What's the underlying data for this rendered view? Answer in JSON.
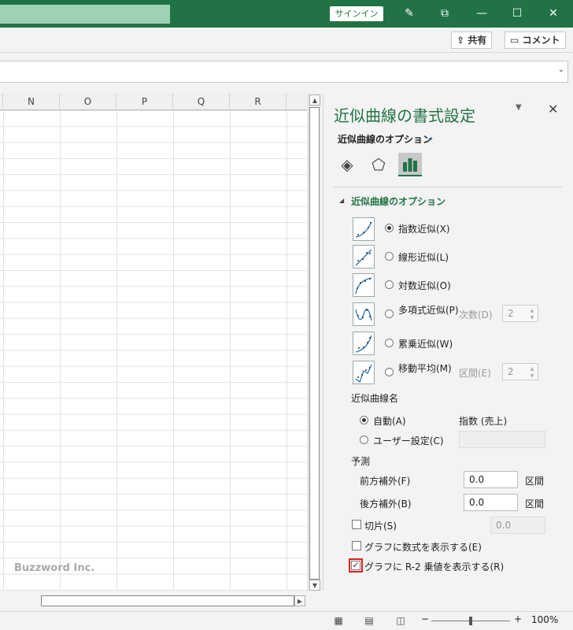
{
  "titlebar": {
    "signin_label": "サインイン",
    "icons": [
      "pen-icon",
      "restore-icon",
      "minimize-icon",
      "maximize-icon",
      "close-icon"
    ]
  },
  "ribbon": {
    "share_label": "共有",
    "comment_label": "コメント"
  },
  "sheet": {
    "columns": [
      "N",
      "O",
      "P",
      "Q",
      "R"
    ],
    "watermark": "Buzzword Inc."
  },
  "pane": {
    "title": "近似曲線の書式設定",
    "options_dropdown": "近似曲線のオプション",
    "section_header": "近似曲線のオプション",
    "trend_types": [
      {
        "label": "指数近似(X)",
        "selected": true
      },
      {
        "label": "線形近似(L)",
        "selected": false
      },
      {
        "label": "対数近似(O)",
        "selected": false
      },
      {
        "label": "多項式近似(P)",
        "selected": false,
        "param_label": "次数(D)",
        "param_value": "2"
      },
      {
        "label": "累乗近似(W)",
        "selected": false
      },
      {
        "label": "移動平均(M)",
        "selected": false,
        "param_label": "区間(E)",
        "param_value": "2"
      }
    ],
    "name_section": {
      "heading": "近似曲線名",
      "auto_label": "自動(A)",
      "auto_value": "指数 (売上)",
      "custom_label": "ユーザー設定(C)",
      "custom_value": ""
    },
    "forecast": {
      "heading": "予測",
      "forward_label": "前方補外(F)",
      "forward_value": "0.0",
      "backward_label": "後方補外(B)",
      "backward_value": "0.0",
      "unit": "区間"
    },
    "intercept": {
      "label": "切片(S)",
      "value": "0.0",
      "checked": false
    },
    "show_equation": {
      "label": "グラフに数式を表示する(E)",
      "checked": false
    },
    "show_r2": {
      "label": "グラフに R-2 乗値を表示する(R)",
      "checked": true
    }
  },
  "statusbar": {
    "zoom_minus": "−",
    "zoom_plus": "+",
    "zoom_level": "100%"
  }
}
